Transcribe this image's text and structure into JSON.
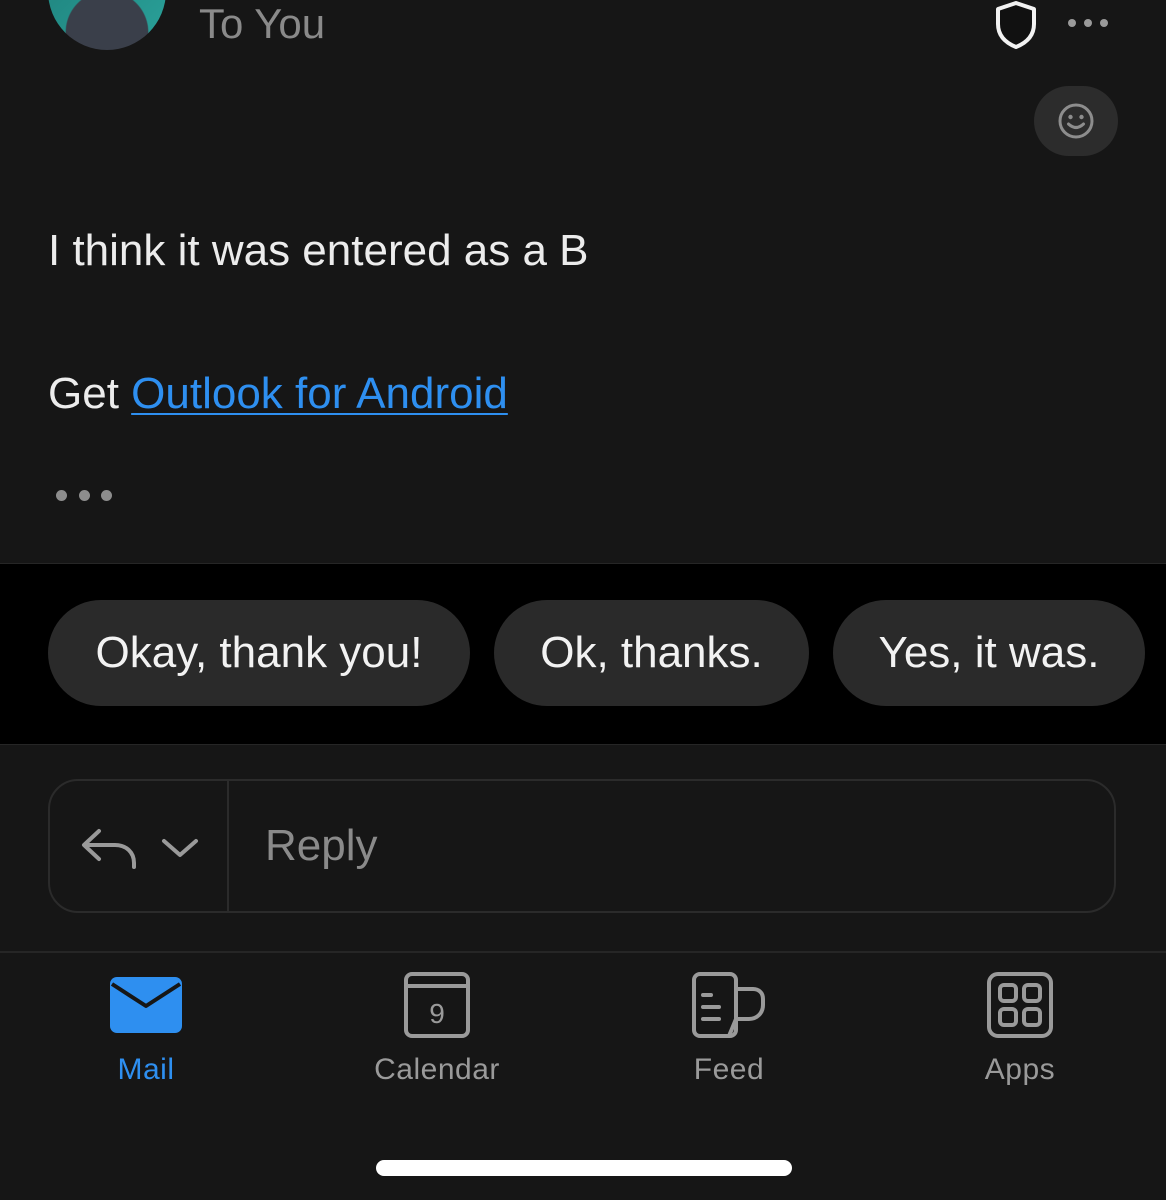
{
  "header": {
    "recipient_line": "To You"
  },
  "message": {
    "body": "I think it was entered as a B",
    "signature_prefix": "Get",
    "signature_link": "Outlook for Android"
  },
  "suggested_replies": [
    "Okay, thank you!",
    "Ok, thanks.",
    "Yes, it was."
  ],
  "reply_bar": {
    "placeholder": "Reply"
  },
  "calendar_day": "9",
  "tabs": [
    {
      "label": "Mail",
      "icon": "mail-icon",
      "active": true
    },
    {
      "label": "Calendar",
      "icon": "calendar-icon",
      "active": false
    },
    {
      "label": "Feed",
      "icon": "feed-icon",
      "active": false
    },
    {
      "label": "Apps",
      "icon": "apps-icon",
      "active": false
    }
  ],
  "colors": {
    "background": "#161616",
    "accent": "#2e8ff0",
    "chip_background": "#2a2a2a",
    "muted_text": "#8a8a8a"
  }
}
